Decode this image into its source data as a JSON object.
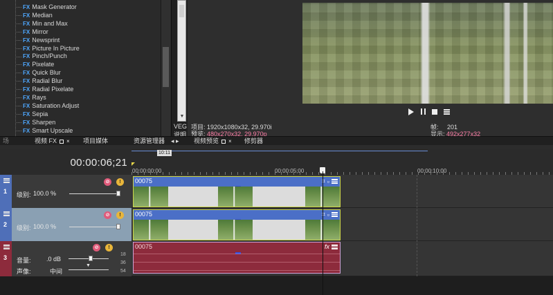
{
  "fx_list": {
    "badge": "FX",
    "items": [
      "Mask Generator",
      "Median",
      "Min and Max",
      "Mirror",
      "Newsprint",
      "Picture In Picture",
      "Pinch/Punch",
      "Pixelate",
      "Quick Blur",
      "Radial Blur",
      "Radial Pixelate",
      "Rays",
      "Saturation Adjust",
      "Sepia",
      "Sharpen",
      "Smart Upscale"
    ]
  },
  "explorer": {
    "label_veg": "VEG",
    "label_desc": "说明"
  },
  "preview": {
    "project_label": "项目:",
    "project_value": "1920x1080x32, 29.970i",
    "preview_label": "预览:",
    "preview_value": "480x270x32, 29.970p",
    "frame_label": "帧:",
    "frame_value": "201",
    "display_label": "显示:",
    "display_value": "492x277x32"
  },
  "tabs": {
    "left_partial": "场",
    "video_fx": "视频 FX",
    "project_media": "项目媒体",
    "explorer": "资源管理器",
    "nav_arrows": "◂ ▸",
    "video_preview": "视频预览",
    "trimmer": "修剪器",
    "close": "×"
  },
  "timeline": {
    "timecode": "00:00:06;21",
    "marker": "10:11",
    "ticks": [
      "00:00:00;00",
      "00:00:05;00",
      "00:00:10;00"
    ]
  },
  "tracks": [
    {
      "number": "1",
      "level_label": "级别:",
      "level_value": "100.0 %",
      "level_fraction": 1.0,
      "clip_name": "00075",
      "color": "#4f6fb8"
    },
    {
      "number": "2",
      "level_label": "级别:",
      "level_value": "100.0 %",
      "level_fraction": 1.0,
      "clip_name": "00075",
      "color": "#4f6fb8"
    }
  ],
  "audio_track": {
    "number": "3",
    "volume_label": "音量:",
    "volume_value": ".0 dB",
    "pan_label": "声像:",
    "pan_value": "中间",
    "clip_name": "00075",
    "db_marks": [
      "18",
      "36",
      "54"
    ],
    "fx_label": "fx",
    "color": "#8d2b3c"
  },
  "icons": {
    "mute": "mute-icon",
    "solo": "solo-icon",
    "crop": "crop-icon",
    "track_menu": "hamburger-icon"
  }
}
